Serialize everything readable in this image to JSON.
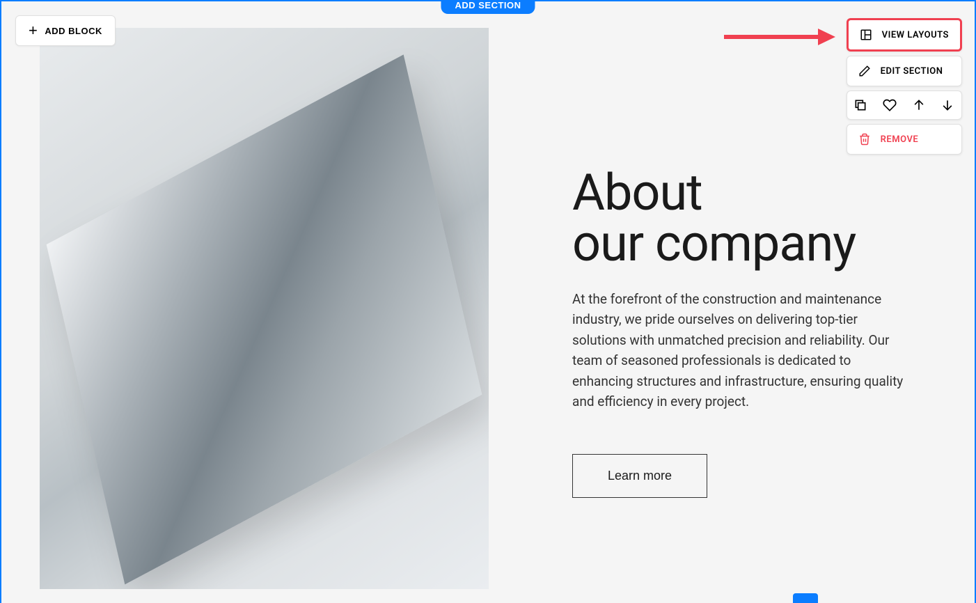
{
  "topBar": {
    "addSection": "ADD SECTION",
    "addBlock": "ADD BLOCK"
  },
  "contextMenu": {
    "viewLayouts": "VIEW LAYOUTS",
    "editSection": "EDIT SECTION",
    "remove": "REMOVE"
  },
  "content": {
    "headingLine1": "About",
    "headingLine2": "our company",
    "body": "At the forefront of the construction and maintenance industry, we pride ourselves on delivering top-tier solutions with unmatched precision and reliability. Our team of seasoned professionals is dedicated to enhancing structures and infrastructure, ensuring quality and efficiency in every project.",
    "cta": "Learn more"
  },
  "colors": {
    "accent": "#0b7dff",
    "highlight": "#f04050"
  }
}
